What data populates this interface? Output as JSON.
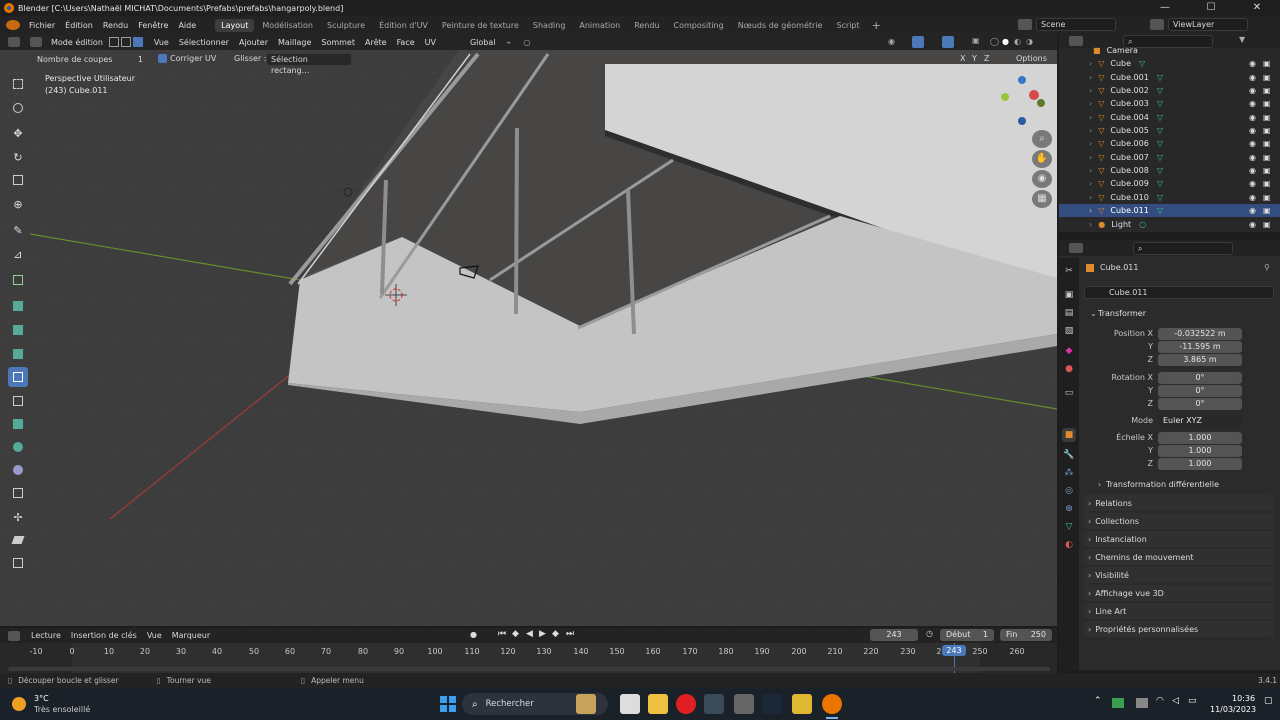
{
  "window": {
    "title": "Blender [C:\\Users\\Nathaël MICHAT\\Documents\\Prefabs\\prefabs\\hangarpoly.blend]",
    "minimize": "—",
    "maximize": "☐",
    "close": "✕"
  },
  "menu": {
    "items": [
      "Fichier",
      "Édition",
      "Rendu",
      "Fenêtre",
      "Aide"
    ],
    "workspaces": [
      "Layout",
      "Modélisation",
      "Sculpture",
      "Édition d'UV",
      "Peinture de texture",
      "Shading",
      "Animation",
      "Rendu",
      "Compositing",
      "Nœuds de géométrie",
      "Script"
    ],
    "active_workspace": "Layout",
    "scene_label": "Scene",
    "view_layer_label": "ViewLayer"
  },
  "viewport_header": {
    "mode": "Mode édition",
    "menus": [
      "Vue",
      "Sélectionner",
      "Ajouter",
      "Maillage",
      "Sommet",
      "Arête",
      "Face",
      "UV"
    ],
    "orientation": "Global"
  },
  "tool_options": {
    "cuts_label": "Nombre de coupes",
    "cuts_value": "1",
    "correct_uv": "Corriger UV",
    "drag_label": "Glisser :",
    "drag_value": "Sélection rectang...",
    "options": "Options",
    "axes": [
      "X",
      "Y",
      "Z"
    ]
  },
  "viewport_overlay": {
    "view_name": "Perspective Utilisateur",
    "object_info": "(243) Cube.011"
  },
  "outliner": {
    "items": [
      "Camera",
      "Cube",
      "Cube.001",
      "Cube.002",
      "Cube.003",
      "Cube.004",
      "Cube.005",
      "Cube.006",
      "Cube.007",
      "Cube.008",
      "Cube.009",
      "Cube.010",
      "Cube.011",
      "Light"
    ],
    "selected": "Cube.011"
  },
  "properties": {
    "object_name": "Cube.011",
    "object_field": "Cube.011",
    "transform_section": "Transformer",
    "location_label": "Position X",
    "location": [
      "-0.032522 m",
      "-11.595 m",
      "3.865 m"
    ],
    "rotation_label": "Rotation X",
    "rotation": [
      "0°",
      "0°",
      "0°"
    ],
    "mode_label": "Mode",
    "mode_value": "Euler XYZ",
    "scale_label": "Échelle X",
    "scale": [
      "1.000",
      "1.000",
      "1.000"
    ],
    "axis_y": "Y",
    "axis_z": "Z",
    "delta": "Transformation différentielle",
    "panels": [
      "Relations",
      "Collections",
      "Instanciation",
      "Chemins de mouvement",
      "Visibilité",
      "Affichage vue 3D",
      "Line Art",
      "Propriétés personnalisées"
    ]
  },
  "timeline": {
    "menus": [
      "Lecture",
      "Insertion de clés",
      "Vue",
      "Marqueur"
    ],
    "current_frame": "243",
    "start_label": "Début",
    "start_value": "1",
    "end_label": "Fin",
    "end_value": "250",
    "ticks": [
      "-10",
      "0",
      "10",
      "20",
      "30",
      "40",
      "50",
      "60",
      "70",
      "80",
      "90",
      "100",
      "110",
      "120",
      "130",
      "140",
      "150",
      "160",
      "170",
      "180",
      "190",
      "200",
      "210",
      "220",
      "230",
      "240",
      "250",
      "260"
    ],
    "playhead": "243"
  },
  "statusbar": {
    "hint1": "Découper boucle et glisser",
    "hint2": "Tourner vue",
    "hint3": "Appeler menu",
    "version": "3.4.1"
  },
  "taskbar": {
    "weather_temp": "3°C",
    "weather_desc": "Très ensoleillé",
    "search": "Rechercher",
    "time": "10:36",
    "date": "11/03/2023"
  },
  "colors": {
    "accent": "#4a78b8",
    "selected_row": "#334d80",
    "viewport_bg": "#3d3d3d",
    "panel_bg": "#2b2b2b"
  }
}
